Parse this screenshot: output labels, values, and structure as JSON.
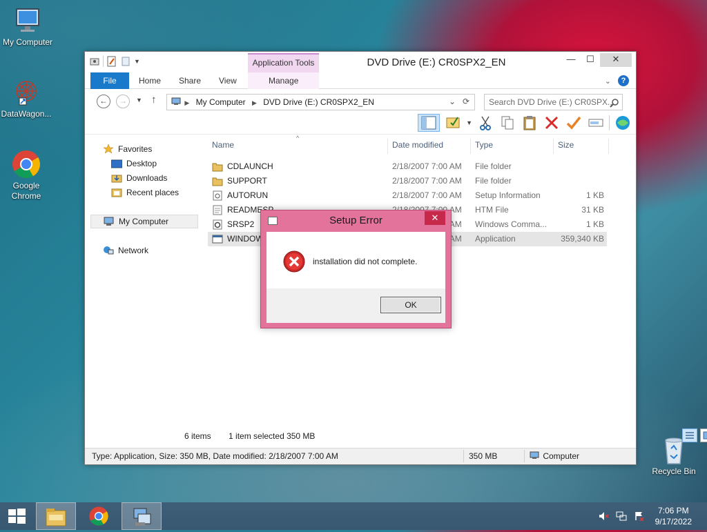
{
  "desktop": {
    "icons": [
      {
        "label": "My Computer"
      },
      {
        "label": "DataWagon..."
      },
      {
        "label": "Google Chrome"
      },
      {
        "label": "Recycle Bin"
      }
    ]
  },
  "explorer": {
    "title": "DVD Drive (E:) CR0SPX2_EN",
    "contextual_tab_group": "Application Tools",
    "ribbon_tabs": [
      "File",
      "Home",
      "Share",
      "View",
      "Manage"
    ],
    "address": {
      "crumbs": [
        "My Computer",
        "DVD Drive (E:) CR0SPX2_EN"
      ]
    },
    "search_placeholder": "Search DVD Drive (E:) CR0SPX...",
    "nav": {
      "favorites": "Favorites",
      "fav_items": [
        "Desktop",
        "Downloads",
        "Recent places"
      ],
      "computer": "My Computer",
      "network": "Network"
    },
    "columns": [
      "Name",
      "Date modified",
      "Type",
      "Size"
    ],
    "files": [
      {
        "name": "CDLAUNCH",
        "date": "2/18/2007 7:00 AM",
        "type": "File folder",
        "size": "",
        "icon": "folder-icon"
      },
      {
        "name": "SUPPORT",
        "date": "2/18/2007 7:00 AM",
        "type": "File folder",
        "size": "",
        "icon": "folder-icon"
      },
      {
        "name": "AUTORUN",
        "date": "2/18/2007 7:00 AM",
        "type": "Setup Information",
        "size": "1 KB",
        "icon": "setup-info-icon"
      },
      {
        "name": "READMESP",
        "date": "2/18/2007 7:00 AM",
        "type": "HTM File",
        "size": "31 KB",
        "icon": "htm-file-icon"
      },
      {
        "name": "SRSP2",
        "date": "2/18/2007 7:00 AM",
        "type": "Windows Comma...",
        "size": "1 KB",
        "icon": "command-script-icon"
      },
      {
        "name": "WINDOW",
        "date": "2/18/2007 7:00 AM",
        "type": "Application",
        "size": "359,340 KB",
        "icon": "application-icon"
      }
    ],
    "selected_row": 5,
    "status_left": "6 items",
    "status_selected": "1 item selected  350 MB",
    "statusbar": {
      "details": "Type: Application, Size: 350 MB, Date modified: 2/18/2007 7:00 AM",
      "size": "350 MB",
      "location": "Computer"
    }
  },
  "dialog": {
    "title": "Setup Error",
    "message": "installation did not complete.",
    "ok_label": "OK",
    "close_label": "✕"
  },
  "taskbar": {
    "time": "7:06 PM",
    "date": "9/17/2022"
  },
  "colors": {
    "file_tab": "#1979ca",
    "dialog_frame": "#e4739b",
    "dialog_close": "#c7294b",
    "taskbar": "#3a5a72"
  }
}
